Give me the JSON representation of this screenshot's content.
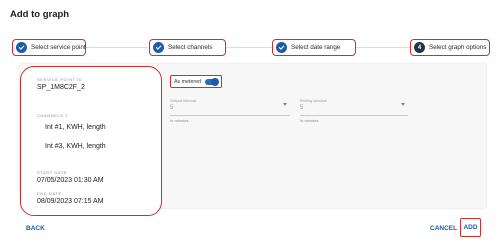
{
  "dialog": {
    "title": "Add to graph"
  },
  "stepper": {
    "steps": [
      {
        "label": "Select service point",
        "state": "done"
      },
      {
        "label": "Select channels",
        "state": "done"
      },
      {
        "label": "Select date range",
        "state": "done"
      },
      {
        "label": "Select graph options",
        "state": "current",
        "number": "4"
      }
    ]
  },
  "summary": {
    "service_point_label": "SERVICE POINT ID",
    "service_point_value": "SP_1M8C2F_2",
    "channels_label": "CHANNELS 2",
    "channels": [
      "Int #1, KWH, length",
      "Int #3, KWH, length"
    ],
    "start_label": "START DATE",
    "start_value": "07/05/2023 01:30 AM",
    "end_label": "END DATE",
    "end_value": "08/09/2023 07:15 AM"
  },
  "options": {
    "as_metered_label": "As metered",
    "as_metered_on": true,
    "output_interval": {
      "placeholder": "Output interval",
      "value": "5",
      "helper": "In minutes"
    },
    "rolling_window": {
      "placeholder": "Rolling window",
      "value": "5",
      "helper": "In minutes"
    }
  },
  "actions": {
    "back": "BACK",
    "cancel": "CANCEL",
    "add": "ADD"
  },
  "colors": {
    "accent": "#1e5aa8",
    "highlight": "#d62b2b"
  }
}
